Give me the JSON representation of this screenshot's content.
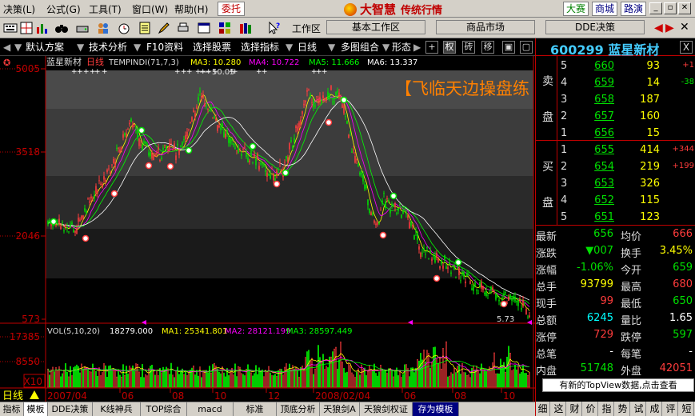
{
  "menu": {
    "items": [
      "决策(L)",
      "公式(G)",
      "工具(T)",
      "窗口(W)",
      "帮助(H)"
    ],
    "trade_button": "委托",
    "brand_name": "大智慧",
    "brand_sub": "传统行情",
    "right_buttons": [
      "大赛",
      "商城",
      "路演"
    ]
  },
  "toolbar": {
    "workspace_label": "工作区",
    "tabs": [
      "基本工作区",
      "商品市场",
      "DDE决策"
    ]
  },
  "toolbar3": {
    "buttons": [
      "默认方案",
      "技术分析",
      "F10资料",
      "选择股票",
      "选择指标",
      "日线",
      "多图组合",
      "形态"
    ],
    "squares": [
      "+",
      "权",
      "砖",
      "移"
    ]
  },
  "chart": {
    "stock_name": "蓝星新材",
    "period": "日线",
    "indicator": "TEMPINDI(71,7,3)",
    "ma_labels": [
      {
        "name": "MA3",
        "value": "10.280",
        "color": "#ffff00"
      },
      {
        "name": "MA4",
        "value": "10.722",
        "color": "#ff00ff"
      },
      {
        "name": "MA5",
        "value": "11.666",
        "color": "#00ff00"
      },
      {
        "name": "MA6",
        "value": "13.337",
        "color": "#ffffff"
      }
    ],
    "price_axis": [
      "5005",
      "3518",
      "2046",
      "573"
    ],
    "peak_label": "50.05",
    "low_label": "5.73",
    "overlay_text": "【飞临天边操盘练",
    "vol_label": "VOL(5,10,20)",
    "vol_value": "18279.000",
    "vol_ma": [
      {
        "name": "MA1",
        "value": "25341.801",
        "color": "#ffff00"
      },
      {
        "name": "MA2",
        "value": "28121.199",
        "color": "#ff00ff"
      },
      {
        "name": "MA3",
        "value": "28597.449",
        "color": "#00ff00"
      }
    ],
    "vol_axis": [
      "17385",
      "8550",
      "X10"
    ],
    "date_axis": [
      "2007/04",
      "06",
      "08",
      "10",
      "12",
      "2008/02/04",
      "06",
      "08",
      "10"
    ],
    "date_corner": "日线"
  },
  "quote": {
    "code": "600299",
    "name": "蓝星新材",
    "close_btn": "X",
    "sell_label": [
      "卖",
      "盘"
    ],
    "buy_label": [
      "买",
      "盘"
    ],
    "asks": [
      {
        "n": "5",
        "price": "660",
        "vol": "93",
        "chg": "+1"
      },
      {
        "n": "4",
        "price": "659",
        "vol": "14",
        "chg": "-38"
      },
      {
        "n": "3",
        "price": "658",
        "vol": "187",
        "chg": ""
      },
      {
        "n": "2",
        "price": "657",
        "vol": "160",
        "chg": ""
      },
      {
        "n": "1",
        "price": "656",
        "vol": "15",
        "chg": ""
      }
    ],
    "bids": [
      {
        "n": "1",
        "price": "655",
        "vol": "414",
        "chg": "+344"
      },
      {
        "n": "2",
        "price": "654",
        "vol": "219",
        "chg": "+199"
      },
      {
        "n": "3",
        "price": "653",
        "vol": "326",
        "chg": ""
      },
      {
        "n": "4",
        "price": "652",
        "vol": "115",
        "chg": ""
      },
      {
        "n": "5",
        "price": "651",
        "vol": "123",
        "chg": ""
      }
    ],
    "stats": [
      {
        "l1": "最新",
        "v1": "656",
        "c1": "green",
        "l2": "均价",
        "v2": "666",
        "c2": "red"
      },
      {
        "l1": "涨跌",
        "v1": "▼007",
        "c1": "green",
        "l2": "换手",
        "v2": "3.45%",
        "c2": "yellow"
      },
      {
        "l1": "涨幅",
        "v1": "-1.06%",
        "c1": "green",
        "l2": "今开",
        "v2": "659",
        "c2": "green"
      },
      {
        "l1": "总手",
        "v1": "93799",
        "c1": "yellow",
        "l2": "最高",
        "v2": "680",
        "c2": "red"
      },
      {
        "l1": "现手",
        "v1": "99",
        "c1": "red",
        "l2": "最低",
        "v2": "650",
        "c2": "green"
      },
      {
        "l1": "总额",
        "v1": "6245",
        "c1": "cyan",
        "l2": "量比",
        "v2": "1.65",
        "c2": "white"
      },
      {
        "l1": "涨停",
        "v1": "729",
        "c1": "red",
        "l2": "跌停",
        "v2": "597",
        "c2": "green"
      },
      {
        "l1": "总笔",
        "v1": "-",
        "c1": "white",
        "l2": "每笔",
        "v2": "-",
        "c2": "white"
      },
      {
        "l1": "内盘",
        "v1": "51748",
        "c1": "green",
        "l2": "外盘",
        "v2": "42051",
        "c2": "red"
      }
    ],
    "topview": "有新的TopView数据,点击查看",
    "bottom_tabs": [
      "细",
      "这",
      "财",
      "价",
      "指",
      "势",
      "试",
      "成",
      "评",
      "短"
    ]
  },
  "bottom_tabs": [
    "指标",
    "模板",
    "DDE决策",
    "K线神兵",
    "TOP综合",
    "macd",
    "标准",
    "顶底分析",
    "天狼剑A",
    "天狼剑权证",
    "存为模板"
  ],
  "colors": {
    "up": "#ff3c3c",
    "down": "#00e000",
    "axis_red": "#c00000"
  }
}
